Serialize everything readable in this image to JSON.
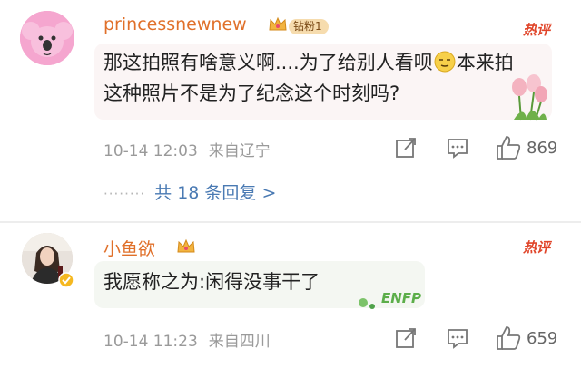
{
  "comments": [
    {
      "username": "princessnewnew",
      "badge": "钻粉1",
      "hot_label": "热评",
      "text_part1": "那这拍照有啥意义啊....为了给别人看呗",
      "text_part2": "本来拍这种照片不是为了纪念这个时刻吗?",
      "date": "10-14 12:03",
      "location": "来自辽宁",
      "like_count": "869",
      "replies_label": "共 18 条回复 >",
      "icons": [
        "koala-avatar",
        "crown-icon",
        "slightly-smiling-emoji-icon",
        "tulip-sticker",
        "share-icon",
        "reply-icon",
        "like-icon"
      ]
    },
    {
      "username": "小鱼欲",
      "hot_label": "热评",
      "text": "我愿称之为:闲得没事干了",
      "sticker_text": "ENFP",
      "date": "10-14 11:23",
      "location": "来自四川",
      "like_count": "659",
      "icons": [
        "profile-photo-avatar",
        "crown-icon",
        "verified-badge-icon",
        "enfp-sticker",
        "share-icon",
        "reply-icon",
        "like-icon"
      ]
    }
  ],
  "colors": {
    "username": "#e0702a",
    "hot": "#e0452a",
    "link": "#4a7ab3",
    "meta": "#9a9a9a"
  }
}
